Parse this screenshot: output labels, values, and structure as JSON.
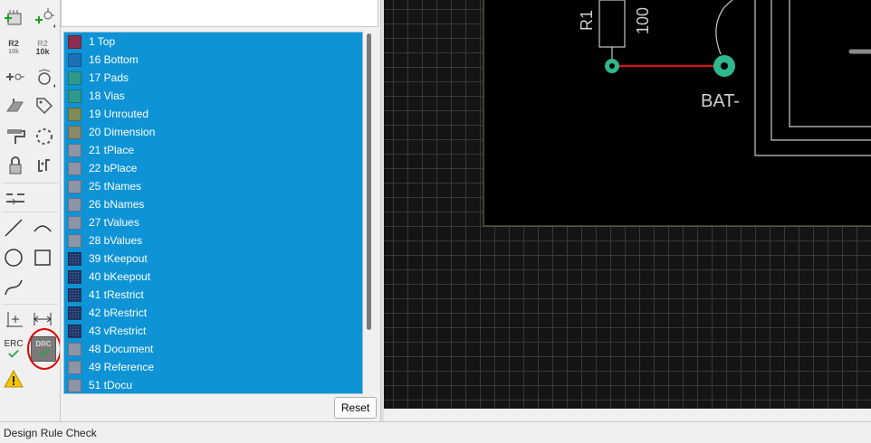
{
  "toolbar": {
    "tools": [
      {
        "name": "add-part-icon"
      },
      {
        "name": "pin-icon"
      },
      {
        "name": "name-tool",
        "label": "R2",
        "sub": "10k"
      },
      {
        "name": "value-tool",
        "label": "R2",
        "sub": "10k"
      },
      {
        "name": "smash-icon"
      },
      {
        "name": "change-icon"
      },
      {
        "name": "paint-icon"
      },
      {
        "name": "attribute-icon"
      },
      {
        "name": "brush-icon"
      },
      {
        "name": "group-icon"
      },
      {
        "name": "lock-icon"
      },
      {
        "name": "replace-icon"
      },
      {
        "name": "split-icon"
      },
      {
        "name": "line-icon"
      },
      {
        "name": "arc-icon"
      },
      {
        "name": "circle-icon"
      },
      {
        "name": "rect-icon"
      },
      {
        "name": "spline-icon"
      },
      {
        "name": "mark-icon"
      },
      {
        "name": "dimension-icon"
      },
      {
        "name": "erc-icon",
        "label": "ERC"
      },
      {
        "name": "drc-icon",
        "label": "DRC"
      },
      {
        "name": "warning-icon"
      }
    ],
    "name_label": "R2",
    "name_sub": "10k",
    "value_label": "R2",
    "value_sub": "10k",
    "erc_label": "ERC",
    "drc_label": "DRC"
  },
  "layers": [
    {
      "label": "1 Top",
      "color": "#8b2e4f",
      "pattern": "solid"
    },
    {
      "label": "16 Bottom",
      "color": "#1e6fb8",
      "pattern": "solid"
    },
    {
      "label": "17 Pads",
      "color": "#2e9a8c",
      "pattern": "solid"
    },
    {
      "label": "18 Vias",
      "color": "#2e9a8c",
      "pattern": "solid"
    },
    {
      "label": "19 Unrouted",
      "color": "#7f8a56",
      "pattern": "solid"
    },
    {
      "label": "20 Dimension",
      "color": "#8a8a6a",
      "pattern": "solid"
    },
    {
      "label": "21 tPlace",
      "color": "#8c95a8",
      "pattern": "solid"
    },
    {
      "label": "22 bPlace",
      "color": "#8c95a8",
      "pattern": "solid"
    },
    {
      "label": "25 tNames",
      "color": "#8c95a8",
      "pattern": "solid"
    },
    {
      "label": "26 bNames",
      "color": "#8c95a8",
      "pattern": "solid"
    },
    {
      "label": "27 tValues",
      "color": "#8c95a8",
      "pattern": "solid"
    },
    {
      "label": "28 bValues",
      "color": "#8c95a8",
      "pattern": "solid"
    },
    {
      "label": "39 tKeepout",
      "color": "#1d2f5a",
      "pattern": "dots"
    },
    {
      "label": "40 bKeepout",
      "color": "#1d2f5a",
      "pattern": "dots"
    },
    {
      "label": "41 tRestrict",
      "color": "#1d2f5a",
      "pattern": "dots"
    },
    {
      "label": "42 bRestrict",
      "color": "#1d2f5a",
      "pattern": "dots"
    },
    {
      "label": "43 vRestrict",
      "color": "#1d2f5a",
      "pattern": "dots"
    },
    {
      "label": "48 Document",
      "color": "#8c95a8",
      "pattern": "solid"
    },
    {
      "label": "49 Reference",
      "color": "#8c95a8",
      "pattern": "solid"
    },
    {
      "label": "51 tDocu",
      "color": "#8c95a8",
      "pattern": "solid"
    }
  ],
  "reset_label": "Reset",
  "canvas": {
    "part_name": "R1",
    "part_value": "100",
    "net_label": "BAT-"
  },
  "status": {
    "text": "Design Rule Check"
  },
  "colors": {
    "selection": "#0d93d6",
    "canvas_bg": "#141414",
    "trace": "#c81a1a",
    "pad": "#2fb88e",
    "highlight_circle": "#e00000"
  }
}
